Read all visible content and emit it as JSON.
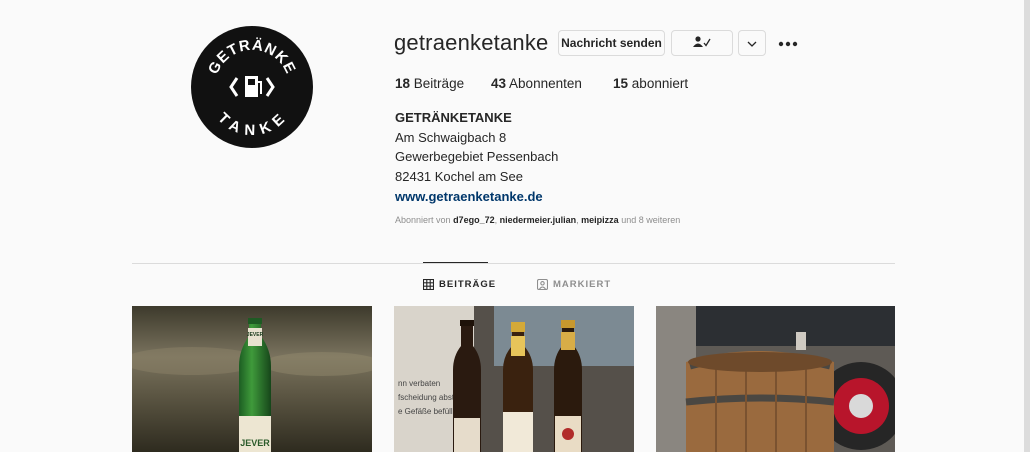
{
  "profile": {
    "username": "getraenketanke",
    "logo": {
      "line1": "GETRÄNKE",
      "line2": "TANKE"
    },
    "buttons": {
      "message": "Nachricht senden"
    },
    "icons": {
      "following": "person-check-icon",
      "chevron": "chevron-down-icon",
      "more": "more-options-icon"
    },
    "stats": [
      {
        "count": "18",
        "label": "Beiträge"
      },
      {
        "count": "43",
        "label": "Abonnenten"
      },
      {
        "count": "15",
        "label": "abonniert"
      }
    ],
    "bio": {
      "name": "GETRÄNKETANKE",
      "line1": "Am Schwaigbach 8",
      "line2": "Gewerbegebiet Pessenbach",
      "line3": "82431 Kochel am See",
      "website": "www.getraenketanke.de"
    },
    "followed_by": {
      "prefix": "Abonniert von",
      "users": [
        "d7ego_72",
        "niedermeier.julian",
        "meipizza"
      ],
      "suffix": "und 8 weiteren"
    }
  },
  "tabs": [
    {
      "label": "BEITRÄGE",
      "icon": "grid-icon",
      "active": true
    },
    {
      "label": "MARKIERT",
      "icon": "tagged-icon",
      "active": false
    }
  ],
  "posts": [
    {
      "subject": "green-beer-bottle",
      "bottle_label": "JEVER"
    },
    {
      "subject": "three-beer-bottles",
      "sign_text": [
        "nn verbaten",
        "fscheidung abstelle",
        "e Gefäße befüllen"
      ]
    },
    {
      "subject": "wooden-barrel"
    }
  ],
  "colors": {
    "background": "#fafafa",
    "link": "#00376b",
    "muted": "#8e8e8e",
    "border": "#dbdbdb"
  }
}
